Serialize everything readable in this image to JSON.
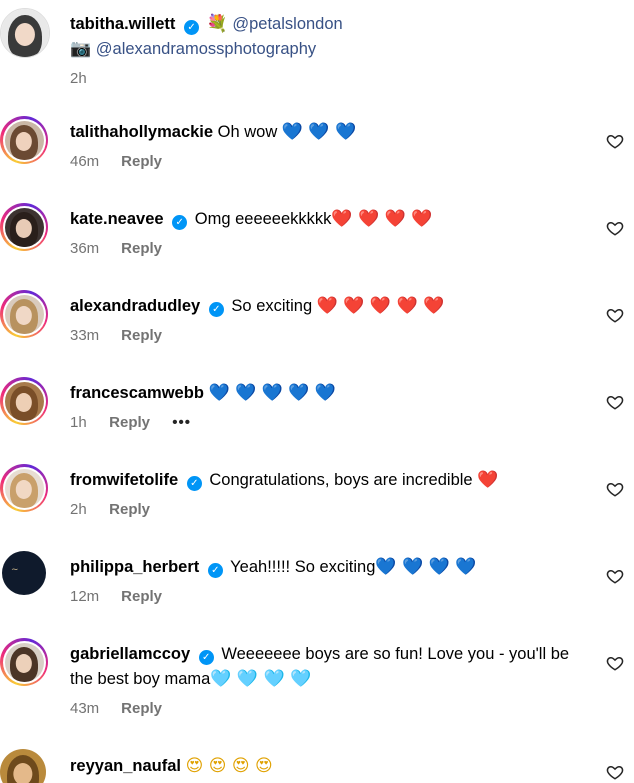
{
  "post": {
    "author": "tabitha.willett",
    "line1_mention": "@petalslondon",
    "line2_mention": "@alexandramossphotography",
    "bouquet_emoji": "💐",
    "camera_emoji": "📷",
    "time": "2h"
  },
  "comments": [
    {
      "user": "talithahollymackie",
      "verified": false,
      "text": "Oh wow",
      "emojis": "💙 💙 💙",
      "time": "46m",
      "reply": "Reply"
    },
    {
      "user": "kate.neavee",
      "verified": true,
      "text": "Omg eeeeeekkkkk",
      "emojis": "❤️ ❤️ ❤️ ❤️",
      "time": "36m",
      "reply": "Reply"
    },
    {
      "user": "alexandradudley",
      "verified": true,
      "text": "So exciting",
      "emojis": "❤️ ❤️ ❤️ ❤️ ❤️",
      "time": "33m",
      "reply": "Reply"
    },
    {
      "user": "francescamwebb",
      "verified": false,
      "text": "",
      "emojis": "💙 💙 💙 💙 💙",
      "time": "1h",
      "reply": "Reply",
      "more": "•••"
    },
    {
      "user": "fromwifetolife",
      "verified": true,
      "text": "Congratulations, boys are incredible",
      "emojis": "❤️",
      "time": "2h",
      "reply": "Reply"
    },
    {
      "user": "philippa_herbert",
      "verified": true,
      "text": "Yeah!!!!! So exciting",
      "emojis": "💙 💙 💙 💙",
      "time": "12m",
      "reply": "Reply"
    },
    {
      "user": "gabriellamccoy",
      "verified": true,
      "text": "Weeeeeee boys are so fun! Love you - you'll be the best boy mama",
      "emojis": "🩵 🩵 🩵 🩵",
      "time": "43m",
      "reply": "Reply"
    },
    {
      "user": "reyyan_naufal",
      "verified": false,
      "text": "",
      "emojis": "😍 😍 😍 😍",
      "time": "",
      "reply": ""
    }
  ],
  "icons": {
    "like": "heart-outline-icon",
    "verified": "verified-badge-icon"
  },
  "colors": {
    "verified_blue": "#0095f6",
    "mention": "#385185",
    "meta_gray": "#737373"
  }
}
